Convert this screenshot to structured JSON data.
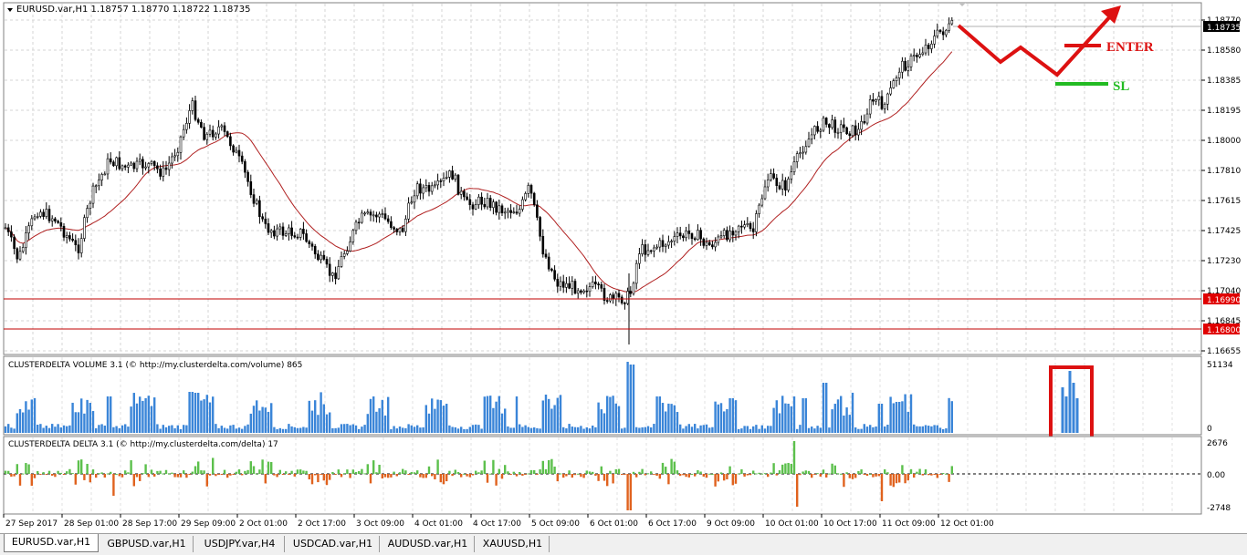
{
  "main_chart": {
    "title": "EURUSD.var,H1  1.18757 1.18770 1.18722 1.18735",
    "y_ticks": [
      "1.18770",
      "1.18580",
      "1.18385",
      "1.18195",
      "1.18000",
      "1.17810",
      "1.17615",
      "1.17425",
      "1.17230",
      "1.17040",
      "1.16845",
      "1.16655"
    ],
    "current_price": "1.18735",
    "level_high": "1.16990",
    "level_low": "1.16800",
    "enter_label": "ENTER",
    "sl_label": "SL"
  },
  "volume_panel": {
    "title": "CLUSTERDELTA VOLUME 3.1 (© http://my.clusterdelta.com/volume) 865",
    "y_max": "51134",
    "y_min": "0"
  },
  "delta_panel": {
    "title": "CLUSTERDELTA DELTA 3.1 (© http://my.clusterdelta.com/delta) 17",
    "y_top": "2676",
    "y_zero": "0.00",
    "y_bottom": "-2748"
  },
  "x_labels": [
    "27 Sep 2017",
    "28 Sep 01:00",
    "28 Sep 17:00",
    "29 Sep 09:00",
    "2 Oct 01:00",
    "2 Oct 17:00",
    "3 Oct 09:00",
    "4 Oct 01:00",
    "4 Oct 17:00",
    "5 Oct 09:00",
    "6 Oct 01:00",
    "6 Oct 17:00",
    "9 Oct 09:00",
    "10 Oct 01:00",
    "10 Oct 17:00",
    "11 Oct 09:00",
    "12 Oct 01:00"
  ],
  "tabs": [
    "EURUSD.var,H1",
    "GBPUSD.var,H1",
    "USDJPY.var,H4",
    "USDCAD.var,H1",
    "AUDUSD.var,H1",
    "XAUUSD,H1"
  ],
  "colors": {
    "bull_volume": "#3a85d8",
    "delta_pos": "#5cc04c",
    "delta_neg": "#e0621e",
    "ma": "#b02020",
    "level": "#c00000",
    "annotation": "#dd1111",
    "sl": "#22bb22"
  }
}
